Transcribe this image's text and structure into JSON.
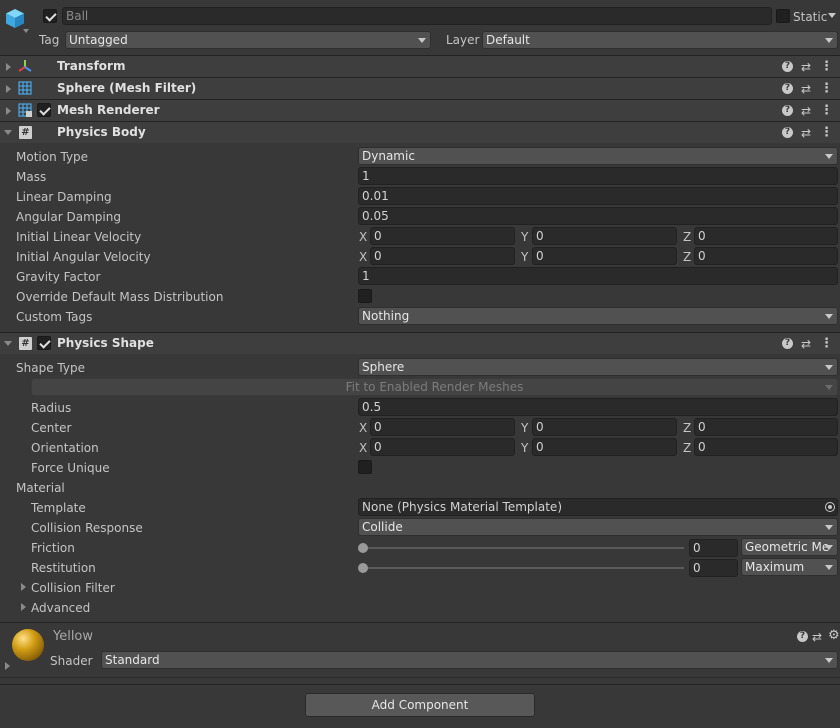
{
  "object": {
    "name": "Ball",
    "static_label": "Static",
    "tag_label": "Tag",
    "tag_value": "Untagged",
    "layer_label": "Layer",
    "layer_value": "Default"
  },
  "components": {
    "transform": "Transform",
    "mesh_filter": "Sphere (Mesh Filter)",
    "mesh_renderer": "Mesh Renderer",
    "physics_body": "Physics Body",
    "physics_shape": "Physics Shape"
  },
  "header_icons": {
    "help": "?",
    "preset": "⇄",
    "menu": "⋮"
  },
  "physics_body": {
    "motion_type_label": "Motion Type",
    "motion_type_value": "Dynamic",
    "mass_label": "Mass",
    "mass_value": "1",
    "linear_damping_label": "Linear Damping",
    "linear_damping_value": "0.01",
    "angular_damping_label": "Angular Damping",
    "angular_damping_value": "0.05",
    "initial_linear_velocity_label": "Initial Linear Velocity",
    "initial_angular_velocity_label": "Initial Angular Velocity",
    "gravity_factor_label": "Gravity Factor",
    "gravity_factor_value": "1",
    "override_mass_label": "Override Default Mass Distribution",
    "custom_tags_label": "Custom Tags",
    "custom_tags_value": "Nothing"
  },
  "vector_axes": {
    "x": "X",
    "y": "Y",
    "z": "Z",
    "zero": "0"
  },
  "physics_shape": {
    "shape_type_label": "Shape Type",
    "shape_type_value": "Sphere",
    "fit_button": "Fit to Enabled Render Meshes",
    "radius_label": "Radius",
    "radius_value": "0.5",
    "center_label": "Center",
    "orientation_label": "Orientation",
    "force_unique_label": "Force Unique",
    "material_label": "Material",
    "template_label": "Template",
    "template_value": "None (Physics Material Template)",
    "collision_response_label": "Collision Response",
    "collision_response_value": "Collide",
    "friction_label": "Friction",
    "friction_value": "0",
    "friction_mode": "Geometric Me",
    "restitution_label": "Restitution",
    "restitution_value": "0",
    "restitution_mode": "Maximum",
    "collision_filter_label": "Collision Filter",
    "advanced_label": "Advanced"
  },
  "material": {
    "name": "Yellow",
    "shader_label": "Shader",
    "shader_value": "Standard",
    "color": "#d4a017"
  },
  "add_component": "Add Component"
}
